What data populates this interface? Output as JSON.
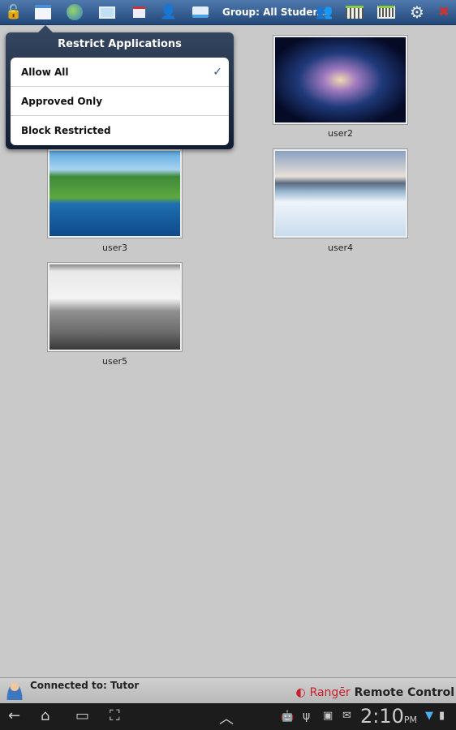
{
  "toolbar": {
    "group_label": "Group: All Students",
    "icons": [
      "unlock-icon",
      "restrict-applications-icon",
      "web-icon",
      "screen-icon",
      "print-restrict-icon",
      "user-logout-icon",
      "printer-icon",
      "group-icon",
      "thumbnail-grid-icon",
      "thumbnail-view-icon",
      "settings-icon",
      "disconnect-icon"
    ]
  },
  "popup": {
    "title": "Restrict Applications",
    "options": [
      {
        "label": "Allow All",
        "selected": true
      },
      {
        "label": "Approved Only",
        "selected": false
      },
      {
        "label": "Block Restricted",
        "selected": false
      }
    ],
    "check": "✓"
  },
  "students": [
    {
      "name": "user2"
    },
    {
      "name": "user3"
    },
    {
      "name": "user4"
    },
    {
      "name": "user5"
    }
  ],
  "status": {
    "connected": "Connected to: Tutor",
    "brand_ranger": "Rangēr",
    "brand_rest": "Remote Control",
    "brand_color": "#c8202a"
  },
  "navbar": {
    "time": "2:10",
    "ampm": "PM"
  }
}
